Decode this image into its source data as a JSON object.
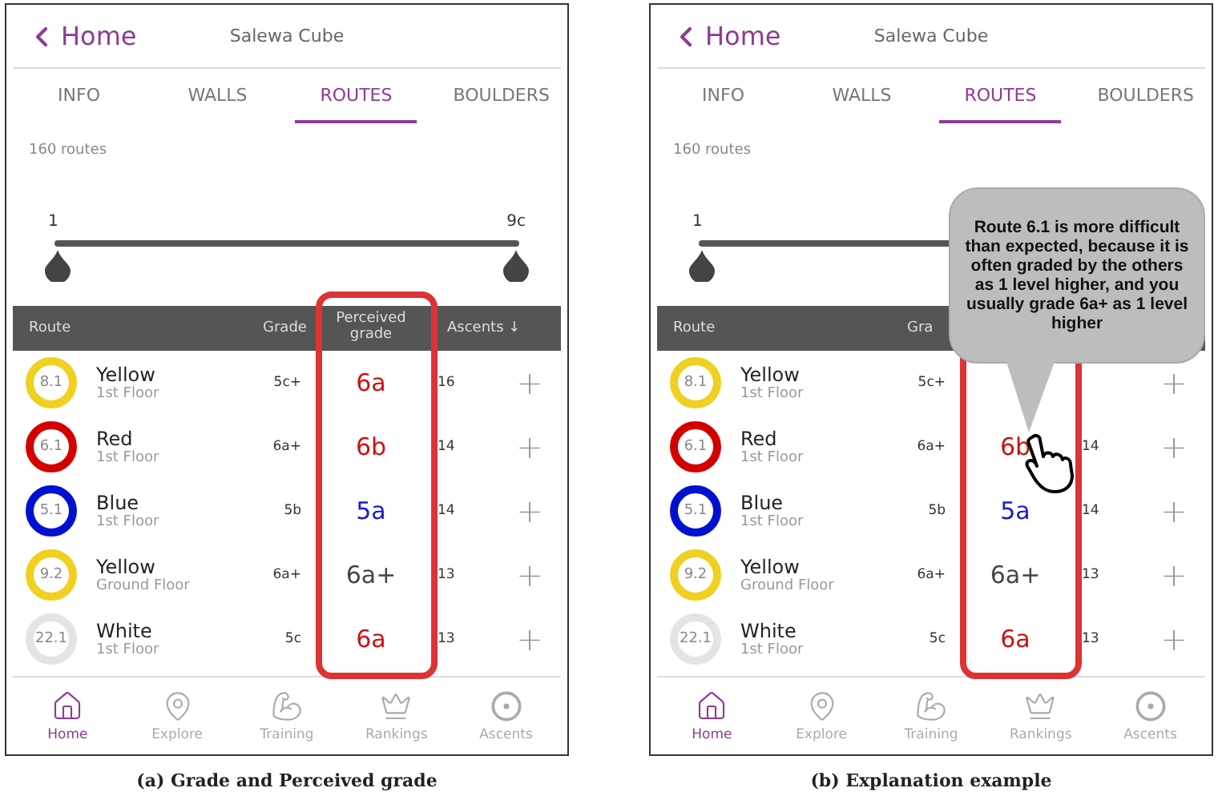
{
  "panels": [
    {
      "back": "Home",
      "title": "Salewa Cube",
      "tabs": [
        {
          "label": "INFO",
          "selected": false
        },
        {
          "label": "WALLS",
          "selected": false
        },
        {
          "label": "ROUTES",
          "selected": true
        },
        {
          "label": "BOULDERS",
          "selected": false
        }
      ],
      "count": "160 routes",
      "range": {
        "min": "1",
        "max": "9c"
      },
      "columns": {
        "route": "Route",
        "grade": "Grade",
        "perceived": "Perceived grade",
        "ascents": "Ascents ↓"
      },
      "rows": [
        {
          "number": "8.1",
          "name": "Yellow",
          "floor": "1st Floor",
          "color": "#f0d020",
          "grade": "5c+",
          "perceived": {
            "text": "6a",
            "color": "#cc1111"
          },
          "ascents": "16",
          "action": "+"
        },
        {
          "number": "6.1",
          "name": "Red",
          "floor": "1st Floor",
          "color": "#d40000",
          "grade": "6a+",
          "perceived": {
            "text": "6b",
            "color": "#cc1111"
          },
          "ascents": "14",
          "action": "+"
        },
        {
          "number": "5.1",
          "name": "Blue",
          "floor": "1st Floor",
          "color": "#0010d0",
          "grade": "5b",
          "perceived": {
            "text": "5a",
            "color": "#1a1ad0"
          },
          "ascents": "14",
          "action": "+"
        },
        {
          "number": "9.2",
          "name": "Yellow",
          "floor": "Ground Floor",
          "color": "#f0d020",
          "grade": "6a+",
          "perceived": {
            "text": "6a+",
            "color": "#444444"
          },
          "ascents": "13",
          "action": "+"
        },
        {
          "number": "22.1",
          "name": "White",
          "floor": "1st Floor",
          "color": "#e4e4e4",
          "grade": "5c",
          "perceived": {
            "text": "6a",
            "color": "#cc1111"
          },
          "ascents": "13",
          "action": "+"
        }
      ],
      "nav": [
        {
          "kind": "home",
          "label": "Home",
          "selected": true
        },
        {
          "kind": "explore",
          "label": "Explore",
          "selected": false
        },
        {
          "kind": "training",
          "label": "Training",
          "selected": false
        },
        {
          "kind": "rankings",
          "label": "Rankings",
          "selected": false
        },
        {
          "kind": "ascents",
          "label": "Ascents",
          "selected": false
        }
      ],
      "caption": "(a) Grade and Perceived grade"
    },
    {
      "back": "Home",
      "title": "Salewa Cube",
      "tabs": [
        {
          "label": "INFO",
          "selected": false
        },
        {
          "label": "WALLS",
          "selected": false
        },
        {
          "label": "ROUTES",
          "selected": true
        },
        {
          "label": "BOULDERS",
          "selected": false
        }
      ],
      "count": "160 routes",
      "range": {
        "min": "1"
      },
      "columns": {
        "route": "Route",
        "grade": "Gra"
      },
      "rows": [
        {
          "number": "8.1",
          "name": "Yellow",
          "floor": "1st Floor",
          "color": "#f0d020",
          "grade": "5c+",
          "action": "+"
        },
        {
          "number": "6.1",
          "name": "Red",
          "floor": "1st Floor",
          "color": "#d40000",
          "grade": "6a+",
          "perceived": {
            "text": "6b",
            "color": "#cc1111"
          },
          "ascents": "14",
          "action": "+"
        },
        {
          "number": "5.1",
          "name": "Blue",
          "floor": "1st Floor",
          "color": "#0010d0",
          "grade": "5b",
          "perceived": {
            "text": "5a",
            "color": "#1a1ad0"
          },
          "ascents": "14",
          "action": "+"
        },
        {
          "number": "9.2",
          "name": "Yellow",
          "floor": "Ground Floor",
          "color": "#f0d020",
          "grade": "6a+",
          "perceived": {
            "text": "6a+",
            "color": "#444444"
          },
          "ascents": "13",
          "action": "+"
        },
        {
          "number": "22.1",
          "name": "White",
          "floor": "1st Floor",
          "color": "#e4e4e4",
          "grade": "5c",
          "perceived": {
            "text": "6a",
            "color": "#cc1111"
          },
          "ascents": "13",
          "action": "+"
        }
      ],
      "nav": [
        {
          "kind": "home",
          "label": "Home",
          "selected": true
        },
        {
          "kind": "explore",
          "label": "Explore",
          "selected": false
        },
        {
          "kind": "training",
          "label": "Training",
          "selected": false
        },
        {
          "kind": "rankings",
          "label": "Rankings",
          "selected": false
        },
        {
          "kind": "ascents",
          "label": "Ascents",
          "selected": false
        }
      ],
      "tooltip": "Route 6.1 is more difficult than expected, because it is often graded by the others as 1 level higher, and you usually grade 6a+ as 1 level higher",
      "caption": "(b) Explanation example"
    }
  ]
}
